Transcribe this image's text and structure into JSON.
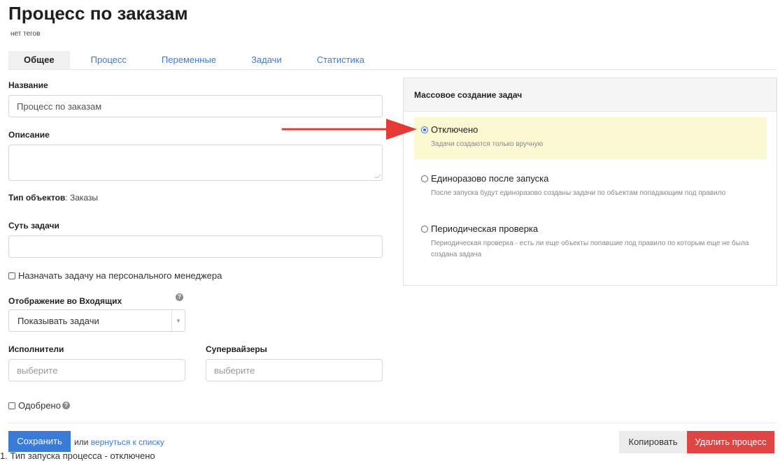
{
  "page": {
    "title": "Процесс по заказам",
    "tags": "нет тегов"
  },
  "tabs": [
    {
      "label": "Общее",
      "active": true
    },
    {
      "label": "Процесс",
      "active": false
    },
    {
      "label": "Переменные",
      "active": false
    },
    {
      "label": "Задачи",
      "active": false
    },
    {
      "label": "Статистика",
      "active": false
    }
  ],
  "form": {
    "name_label": "Название",
    "name_value": "Процесс по заказам",
    "description_label": "Описание",
    "description_value": "",
    "object_type_label": "Тип объектов",
    "object_type_value": ": Заказы",
    "task_essence_label": "Суть задачи",
    "task_essence_value": "",
    "assign_manager_label": "Назначать задачу на персонального менеджера",
    "inbox_display_label": "Отображение во Входящих",
    "inbox_display_value": "Показывать задачи",
    "executors_label": "Исполнители",
    "executors_placeholder": "выберите",
    "supervisors_label": "Супервайзеры",
    "supervisors_placeholder": "выберите",
    "approved_label": "Одобрено"
  },
  "mass_creation": {
    "title": "Массовое создание задач",
    "options": [
      {
        "label": "Отключено",
        "description": "Задачи создаются только вручную",
        "selected": true
      },
      {
        "label": "Единоразово после запуска",
        "description": "После запуска будут единоразово созданы задачи по объектам попадающим под правило",
        "selected": false
      },
      {
        "label": "Периодическая проверка",
        "description": "Периодическая проверка - есть ли еще объекты попавшие под правило по которым еще не была создана задача",
        "selected": false
      }
    ]
  },
  "footer": {
    "save_label": "Сохранить",
    "or_text": "или",
    "back_link": "вернуться к списку",
    "copy_label": "Копировать",
    "delete_label": "Удалить процесс"
  },
  "caption": "1. Тип запуска процесса - отключено",
  "colors": {
    "accent": "#3a7bd5",
    "danger": "#e04545",
    "highlight": "#fbf8d2",
    "arrow": "#e53935"
  },
  "icons": {
    "help": "help-icon",
    "dropdown": "chevron-down-icon",
    "annotation": "red-arrow-icon"
  }
}
